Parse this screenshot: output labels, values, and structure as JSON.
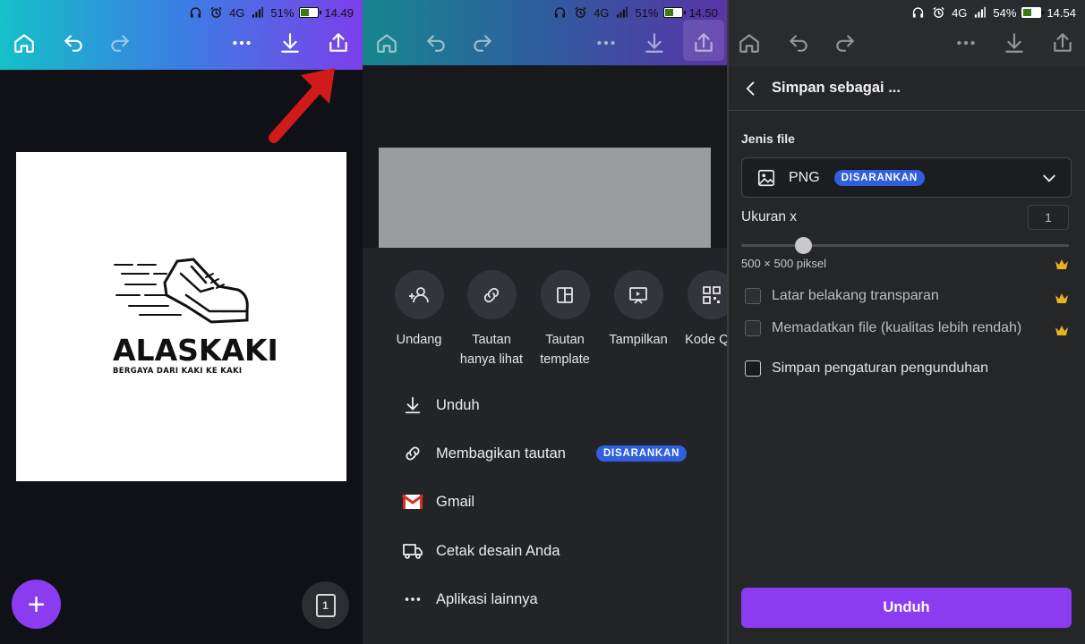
{
  "panels": [
    {
      "status": {
        "signal": "4G",
        "battery_pct": "51%",
        "battery_level": 0.51,
        "time": "14.49"
      },
      "design": {
        "logo_word": "ALASKAKI",
        "logo_tagline": "BERGAYA DARI KAKI KE KAKI"
      },
      "fab_label": "+",
      "page_count": "1"
    },
    {
      "status": {
        "signal": "4G",
        "battery_pct": "51%",
        "battery_level": 0.51,
        "time": "14.50"
      },
      "share_options": [
        {
          "label": "Undang",
          "icon": "invite-icon"
        },
        {
          "label": "Tautan\nhanya lihat",
          "icon": "link-icon"
        },
        {
          "label": "Tautan\ntemplate",
          "icon": "template-icon"
        },
        {
          "label": "Tampilkan",
          "icon": "present-icon"
        },
        {
          "label": "Kode QR",
          "icon": "qr-code-icon"
        }
      ],
      "menu": [
        {
          "label": "Unduh",
          "icon": "download-icon"
        },
        {
          "label": "Membagikan tautan",
          "icon": "link-icon",
          "badge": "DISARANKAN"
        },
        {
          "label": "Gmail",
          "icon": "gmail-icon"
        },
        {
          "label": "Cetak desain Anda",
          "icon": "truck-icon"
        },
        {
          "label": "Aplikasi lainnya",
          "icon": "more-icon"
        }
      ]
    },
    {
      "status": {
        "signal": "4G",
        "battery_pct": "54%",
        "battery_level": 0.54,
        "time": "14.54"
      },
      "header_title": "Simpan sebagai ...",
      "file_type_label": "Jenis file",
      "file_type_value": "PNG",
      "file_type_badge": "DISARANKAN",
      "size_label": "Ukuran x",
      "size_value": "1",
      "size_slider_level": 0.19,
      "dimensions": "500 × 500 piksel",
      "options": [
        {
          "label": "Latar belakang transparan",
          "checked": false,
          "premium": true
        },
        {
          "label": "Memadatkan file (kualitas lebih rendah)",
          "checked": false,
          "premium": true
        },
        {
          "label": "Simpan pengaturan pengunduhan",
          "checked": false,
          "premium": false
        }
      ],
      "download_button": "Unduh"
    }
  ],
  "colors": {
    "brand_purple": "#8b3cf0",
    "badge_blue": "#2f5fdd",
    "crown_gold": "#e8b21f",
    "arrow_red": "#d11a1a"
  }
}
